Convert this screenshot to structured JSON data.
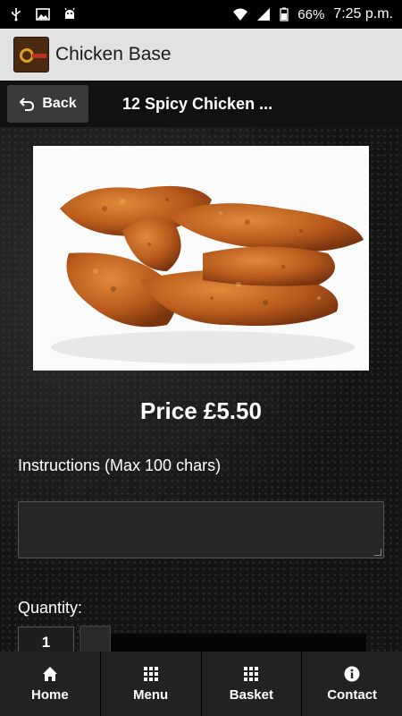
{
  "status_bar": {
    "icons_left": [
      "usb-icon",
      "image-icon",
      "android-icon"
    ],
    "icons_right": [
      "wifi-icon",
      "signal-icon",
      "battery-icon"
    ],
    "battery": "66%",
    "time": "7:25 p.m."
  },
  "app_bar": {
    "logo_icon": "app-logo",
    "title": "Chicken Base"
  },
  "nav": {
    "back_label": "Back",
    "title": "12 Spicy Chicken ..."
  },
  "product": {
    "image_icon": "chicken-strips-photo",
    "price_label": "Price £5.50",
    "instructions_label": "Instructions (Max 100 chars)",
    "instructions_value": "",
    "quantity_label": "Quantity:",
    "quantity_value": "1",
    "quantity_slider_level": 0
  },
  "tabs": [
    {
      "label": "Home",
      "icon": "home-icon"
    },
    {
      "label": "Menu",
      "icon": "grid-icon"
    },
    {
      "label": "Basket",
      "icon": "grid-icon"
    },
    {
      "label": "Contact",
      "icon": "info-icon"
    }
  ],
  "colors": {
    "app_bar_bg": "#e2e2e2",
    "nav_bg": "#111111",
    "back_button_bg": "#3a3a3a",
    "tab_bg": "#222222"
  }
}
